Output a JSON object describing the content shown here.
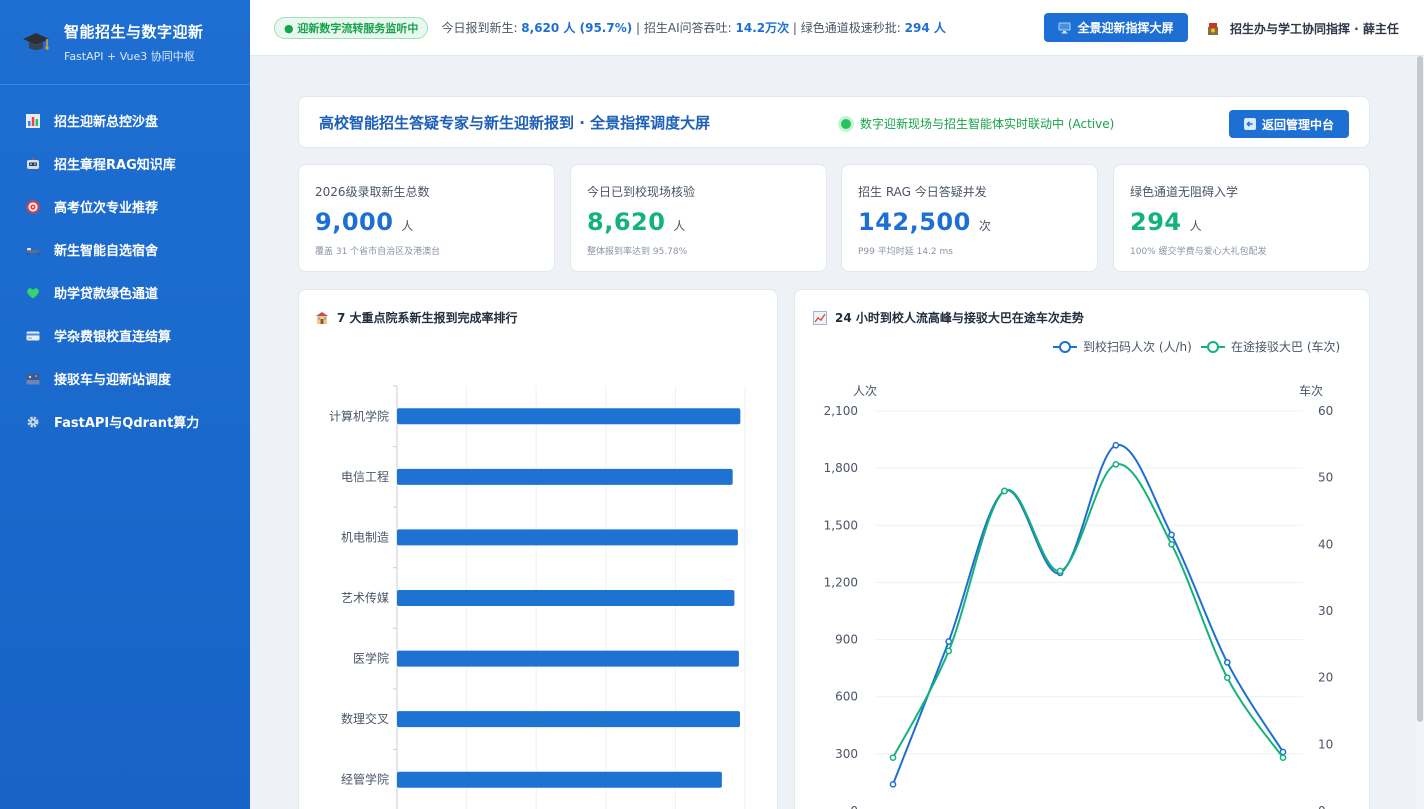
{
  "sidebar": {
    "brand_title": "智能招生与数字迎新",
    "brand_sub": "FastAPI + Vue3 协同中枢",
    "items": [
      {
        "label": "招生迎新总控沙盘",
        "icon": "bar-chart-icon"
      },
      {
        "label": "招生章程RAG知识库",
        "icon": "robot-icon"
      },
      {
        "label": "高考位次专业推荐",
        "icon": "target-icon"
      },
      {
        "label": "新生智能自选宿舍",
        "icon": "bed-icon"
      },
      {
        "label": "助学贷款绿色通道",
        "icon": "green-heart-icon"
      },
      {
        "label": "学杂费银校直连结算",
        "icon": "credit-card-icon"
      },
      {
        "label": "接驳车与迎新站调度",
        "icon": "bus-station-icon"
      },
      {
        "label": "FastAPI与Qdrant算力",
        "icon": "gear-icon"
      }
    ]
  },
  "topbar": {
    "live_badge": "● 迎新数字流转服务监听中",
    "ticker": {
      "t1": "今日报到新生: ",
      "v1": "8,620 人 (95.7%)",
      "t2": " | 招生AI问答吞吐: ",
      "v2": "14.2万次",
      "t3": " | 绿色通道极速秒批: ",
      "v3": "294 人"
    },
    "big_screen_button": "全景迎新指挥大屏",
    "user_label": "招生办与学工协同指挥 · 薛主任"
  },
  "header": {
    "title": "高校智能招生答疑专家与新生迎新报到 · 全景指挥调度大屏",
    "status": "数字迎新现场与招生智能体实时联动中 (Active)",
    "back_button": "返回管理中台"
  },
  "kpis": [
    {
      "label": "2026级录取新生总数",
      "value": "9,000",
      "unit": "人",
      "note": "覆盖 31 个省市自治区及港澳台",
      "color": "#1e6fd3"
    },
    {
      "label": "今日已到校现场核验",
      "value": "8,620",
      "unit": "人",
      "note": "整体报到率达到 95.78%",
      "color": "#14b37a"
    },
    {
      "label": "招生 RAG 今日答疑并发",
      "value": "142,500",
      "unit": "次",
      "note": "P99 平均时延 14.2 ms",
      "color": "#1e6fd3"
    },
    {
      "label": "绿色通道无阻碍入学",
      "value": "294",
      "unit": "人",
      "note": "100% 缓交学费与爱心大礼包配发",
      "color": "#14b37a"
    }
  ],
  "charts": {
    "bar_title": "7 大重点院系新生报到完成率排行",
    "line_title": "24 小时到校人流高峰与接驳大巴在途车次走势"
  },
  "chart_data": [
    {
      "type": "bar",
      "orientation": "horizontal",
      "title": "7 大重点院系新生报到完成率排行",
      "categories": [
        "计算机学院",
        "电信工程",
        "机电制造",
        "艺术传媒",
        "医学院",
        "数理交叉",
        "经管学院"
      ],
      "values": [
        98.5,
        96.3,
        97.8,
        96.8,
        98.1,
        98.4,
        93.2
      ],
      "xlim": [
        0,
        105
      ],
      "color": "#1e73d2"
    },
    {
      "type": "line",
      "title": "24 小时到校人流高峰与接驳大巴在途车次走势",
      "ylabel_left": "人次",
      "ylabel_right": "车次",
      "ylim_left": [
        0,
        2100
      ],
      "ylim_right": [
        0,
        60
      ],
      "yticks_left": [
        "2,100",
        "1,800",
        "1,500",
        "1,200",
        "900",
        "600",
        "300",
        "0"
      ],
      "yticks_right": [
        "60",
        "50",
        "40",
        "30",
        "20",
        "10",
        "0"
      ],
      "legend_position": "top-right",
      "series": [
        {
          "name": "到校扫码人次 (人/h)",
          "axis": "left",
          "color": "#1e6fd3",
          "values": [
            140,
            890,
            1680,
            1250,
            1920,
            1450,
            780,
            310
          ]
        },
        {
          "name": "在途接驳大巴 (车次)",
          "axis": "right",
          "color": "#14b37a",
          "values": [
            8,
            24,
            48,
            36,
            52,
            40,
            20,
            8
          ]
        }
      ]
    }
  ]
}
